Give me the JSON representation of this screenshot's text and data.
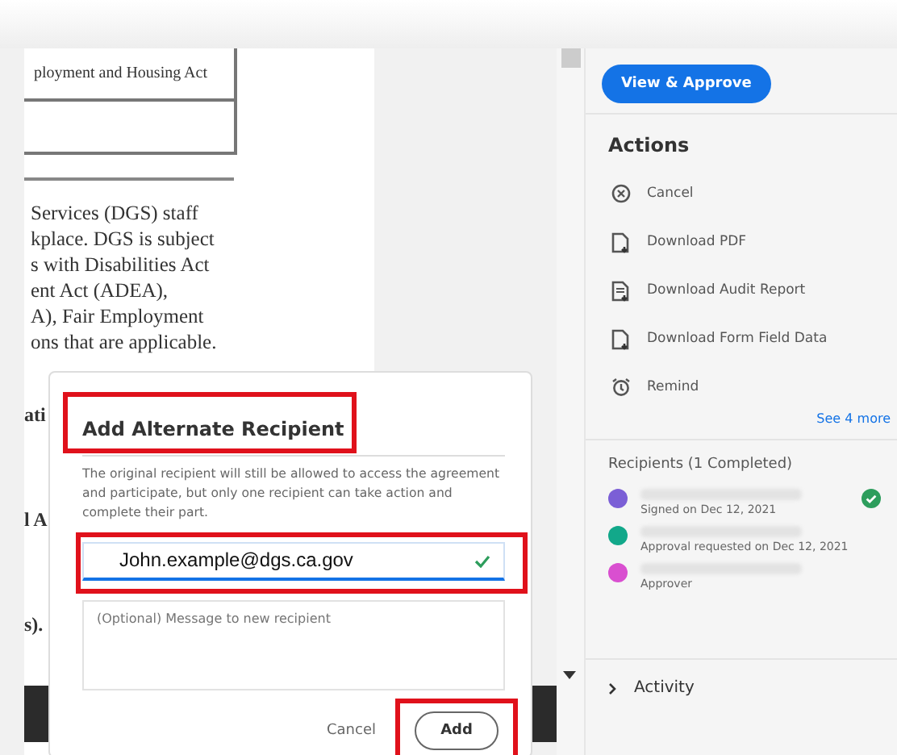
{
  "document": {
    "table_cell": "ployment and Housing Act",
    "paragraph": [
      "Services (DGS) staff",
      "kplace. DGS is subject",
      "s with Disabilities Act",
      "ent Act (ADEA),",
      "A), Fair Employment",
      "ons that are applicable."
    ],
    "fragments": [
      "ati",
      "l A",
      "s)."
    ]
  },
  "dialog": {
    "title": "Add Alternate Recipient",
    "description": "The original recipient will still be allowed to access the agreement and participate, but only one recipient can take action and complete their part.",
    "email": {
      "value": "John.example@dgs.ca.gov",
      "valid": true
    },
    "message": {
      "placeholder": "(Optional) Message to new recipient"
    },
    "buttons": [
      {
        "label": "Cancel",
        "kind": "text"
      },
      {
        "label": "Add",
        "kind": "outline"
      }
    ]
  },
  "panel": {
    "primary_button": "View & Approve",
    "actions_title": "Actions",
    "actions": [
      {
        "label": "Cancel",
        "kind": "cancel"
      },
      {
        "label": "Download PDF",
        "kind": "pdf"
      },
      {
        "label": "Download Audit Report",
        "kind": "report"
      },
      {
        "label": "Download Form Field Data",
        "kind": "data"
      },
      {
        "label": "Remind",
        "kind": "alarm"
      }
    ],
    "see_more": "See 4 more",
    "recipients_title": "Recipients (1 Completed)",
    "recipients": [
      {
        "status": "Signed on Dec 12, 2021",
        "color": "#7b5fd6",
        "completed": true
      },
      {
        "status": "Approval requested on Dec 12, 2021",
        "color": "#12a88a",
        "completed": false
      },
      {
        "status": "Approver",
        "color": "#d94fd0",
        "completed": false
      }
    ],
    "activity": "Activity"
  }
}
